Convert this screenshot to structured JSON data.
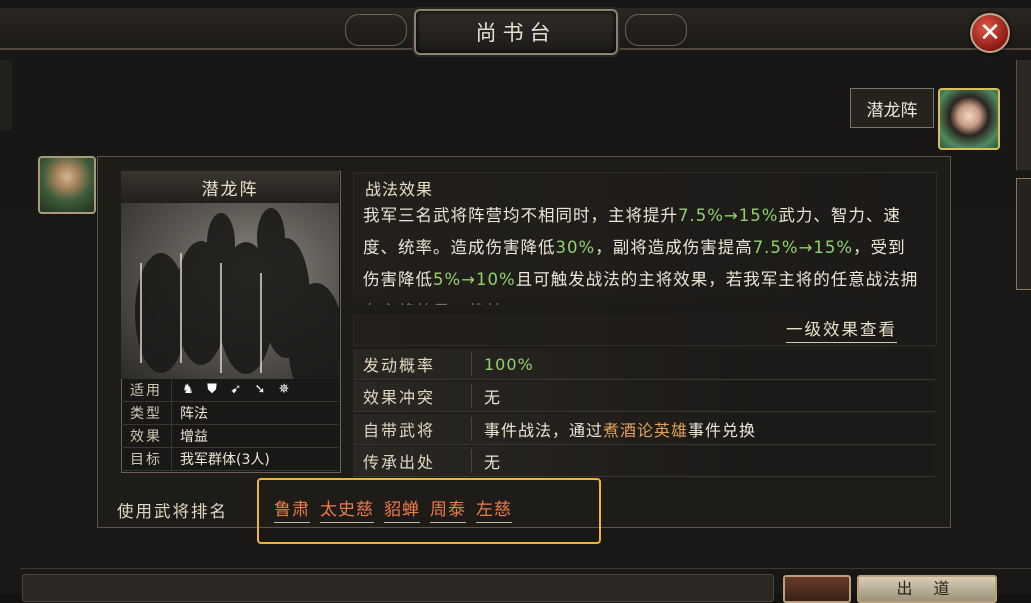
{
  "window": {
    "title": "尚书台",
    "close_label": "✕"
  },
  "formation_tag": "潜龙阵",
  "skill": {
    "name": "潜龙阵",
    "attributes": [
      {
        "key": "适用",
        "value": ""
      },
      {
        "key": "类型",
        "value": "阵法"
      },
      {
        "key": "效果",
        "value": "增益"
      },
      {
        "key": "目标",
        "value": "我军群体(3人)"
      }
    ],
    "troop_icons": [
      "cavalry-icon",
      "shield-icon",
      "archer-icon",
      "spear-icon",
      "siege-icon"
    ]
  },
  "effect": {
    "title": "战法效果",
    "segments": [
      {
        "t": "我军三名武将阵营均不相同时，主将提升",
        "c": ""
      },
      {
        "t": "7.5%→15%",
        "c": "green"
      },
      {
        "t": "武力、智力、速度、统率。造成伤害降低",
        "c": ""
      },
      {
        "t": "30%",
        "c": "green"
      },
      {
        "t": "，副将造成伤害提高",
        "c": ""
      },
      {
        "t": "7.5%→15%",
        "c": "green"
      },
      {
        "t": "，受到伤害降低",
        "c": ""
      },
      {
        "t": "5%→10%",
        "c": "green"
      },
      {
        "t": "且可触发战法的主将效果，若我军主将的任意战法拥有主将效果，使其",
        "c": ""
      }
    ],
    "link": "一级效果查看"
  },
  "props": [
    {
      "key": "发动概率",
      "segments": [
        {
          "t": "100%",
          "c": "green"
        }
      ]
    },
    {
      "key": "效果冲突",
      "segments": [
        {
          "t": "无",
          "c": ""
        }
      ]
    },
    {
      "key": "自带武将",
      "segments": [
        {
          "t": "事件战法，通过",
          "c": ""
        },
        {
          "t": "煮酒论英雄",
          "c": "orange"
        },
        {
          "t": "事件兑换",
          "c": ""
        }
      ]
    },
    {
      "key": "传承出处",
      "segments": [
        {
          "t": "无",
          "c": ""
        }
      ]
    }
  ],
  "users": {
    "label": "使用武将排名",
    "names": [
      "鲁肃",
      "太史慈",
      "貂蝉",
      "周泰",
      "左慈"
    ]
  },
  "bottom": {
    "primary_button": "出 道"
  },
  "colors": {
    "accent": "#f0b828",
    "name_link": "#ee7a4a",
    "value_green": "#8fd36a"
  }
}
